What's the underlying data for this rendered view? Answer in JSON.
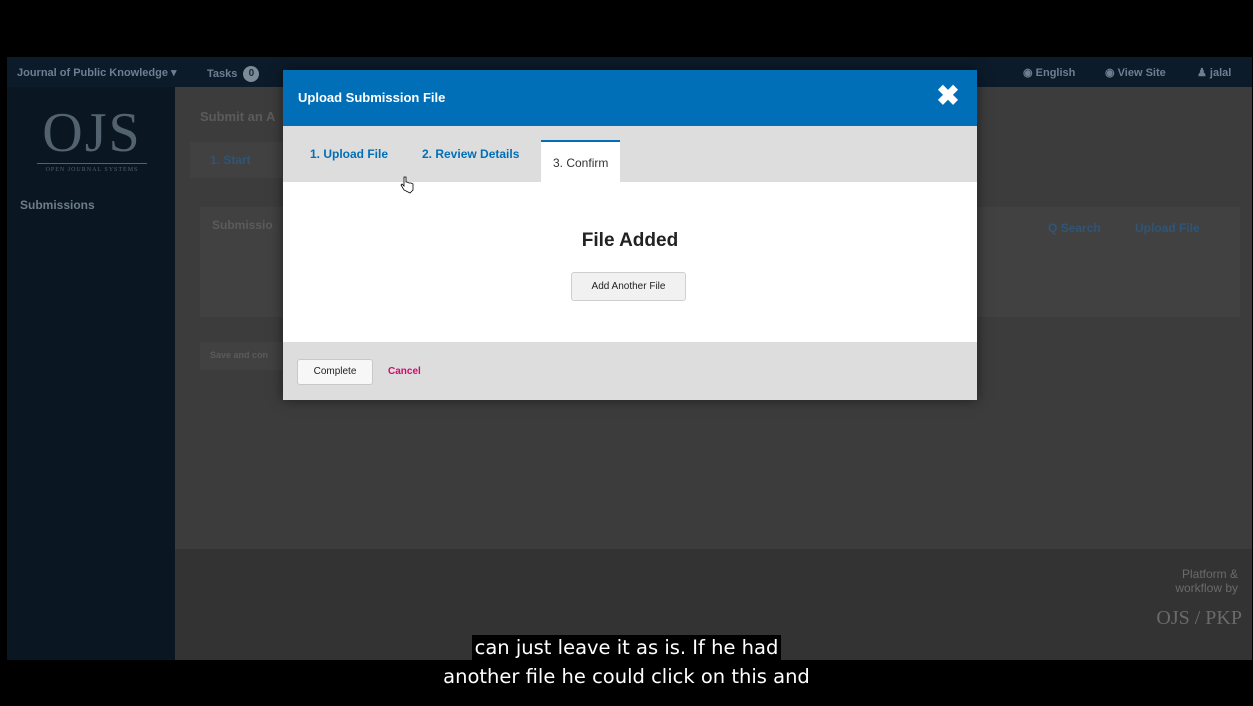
{
  "topnav": {
    "context": "Journal of Public Knowledge ▾",
    "tasks_label": "Tasks",
    "tasks_count": "0",
    "language": "◉ English",
    "view_site": "◉ View Site",
    "user": "♟ jalal"
  },
  "sidebar": {
    "logo_text": "OJS",
    "logo_sub": "OPEN JOURNAL SYSTEMS",
    "submissions": "Submissions"
  },
  "background": {
    "page_title": "Submit an A",
    "step_tab": "1. Start",
    "panel_title": "Submissio",
    "search": "Q Search",
    "upload_file": "Upload File",
    "save_button": "Save and con",
    "footer_platform": "Platform & workflow by",
    "footer_logo": "OJS / PKP"
  },
  "modal": {
    "title": "Upload Submission File",
    "close_icon": "✖",
    "tabs": [
      {
        "label": "1. Upload File"
      },
      {
        "label": "2. Review Details"
      },
      {
        "label": "3. Confirm"
      }
    ],
    "heading": "File Added",
    "add_another": "Add Another File",
    "complete": "Complete",
    "cancel": "Cancel"
  },
  "captions": {
    "line1": "can just leave it as is. If he had",
    "line2": "another file he could click on this and"
  },
  "colors": {
    "header_blue": "#006fb8",
    "cancel_pink": "#d00a6c"
  }
}
